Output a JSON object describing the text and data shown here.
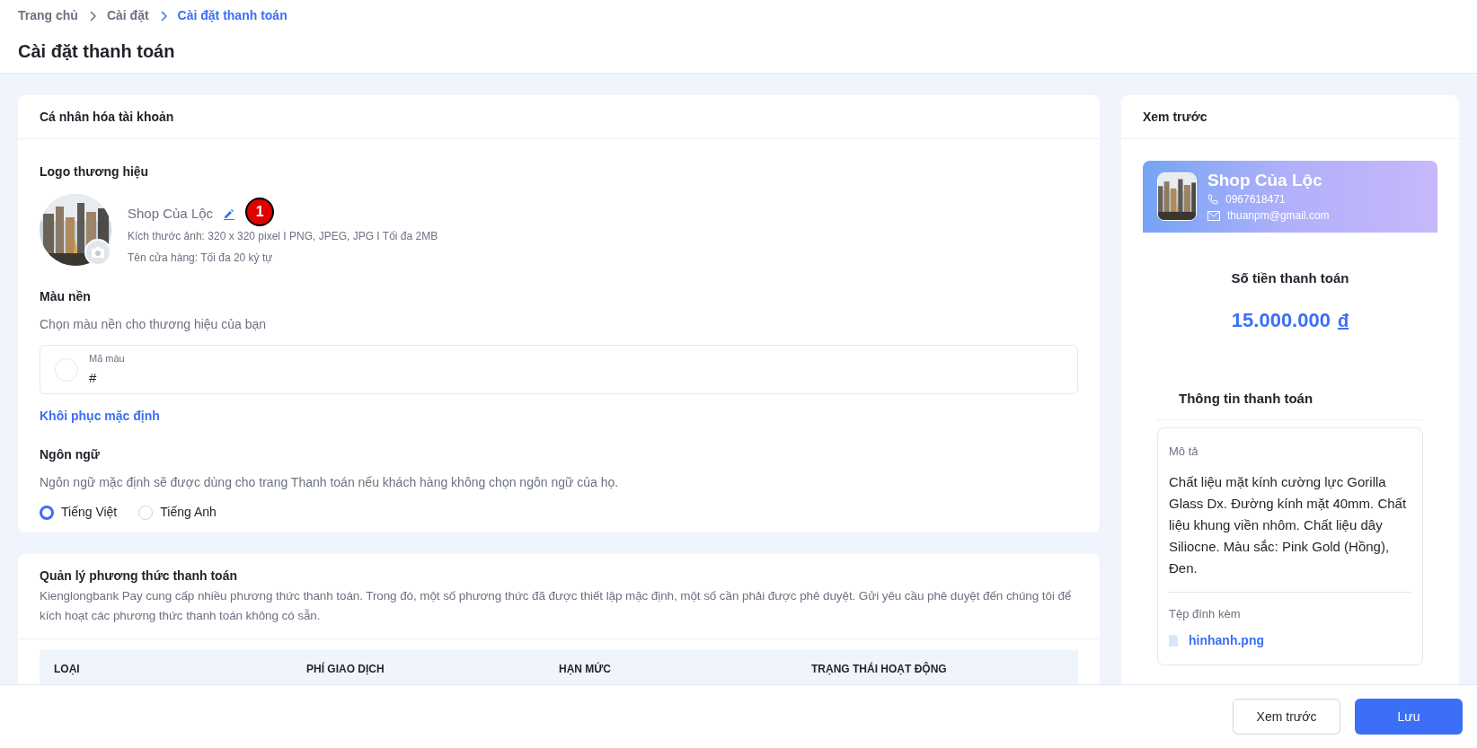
{
  "breadcrumb": [
    {
      "label": "Trang chủ",
      "current": false
    },
    {
      "label": "Cài đặt",
      "current": false
    },
    {
      "label": "Cài đặt thanh toán",
      "current": true
    }
  ],
  "page_title": "Cài đặt thanh toán",
  "personalization": {
    "title": "Cá nhân hóa tài khoản",
    "logo": {
      "heading": "Logo thương hiệu",
      "shop_name": "Shop Của Lộc",
      "badge": "1",
      "size_hint": "Kích thước ảnh: 320 x 320 pixel I PNG, JPEG, JPG I Tối đa 2MB",
      "name_hint": "Tên cửa hàng: Tối đa 20 ký tự"
    },
    "background": {
      "heading": "Màu nền",
      "description": "Chọn màu nền cho thương hiệu của bạn",
      "field_label": "Mã màu",
      "value": "#",
      "reset_link": "Khôi phục mặc định"
    },
    "language": {
      "heading": "Ngôn ngữ",
      "description": "Ngôn ngữ mặc định sẽ được dùng cho trang Thanh toán nếu khách hàng không chọn ngôn ngữ của họ.",
      "options": [
        {
          "label": "Tiếng Việt",
          "selected": true
        },
        {
          "label": "Tiếng Anh",
          "selected": false
        }
      ]
    }
  },
  "payment_methods": {
    "title": "Quản lý phương thức thanh toán",
    "description": "Kienglongbank Pay cung cấp nhiều phương thức thanh toán. Trong đó, một số phương thức đã được thiết lập mặc định, một số cần phải được phê duyệt. Gửi yêu cầu phê duyệt đến chúng tôi để kích hoạt các phương thức thanh toán không có sẵn.",
    "columns": [
      "LOẠI",
      "PHÍ GIAO DỊCH",
      "HẠN MỨC",
      "TRẠNG THÁI HOẠT ĐỘNG"
    ]
  },
  "preview": {
    "title": "Xem trước",
    "shop_name": "Shop Của Lộc",
    "phone": "0967618471",
    "email": "thuanpm@gmail.com",
    "amount_label": "Số tiền thanh toán",
    "amount": "15.000.000",
    "currency": "đ",
    "info_title": "Thông tin thanh toán",
    "description_label": "Mô tả",
    "description": "Chất liệu mặt kính cường lực Gorilla Glass Dx. Đường kính mặt 40mm. Chất liệu khung viền nhôm. Chất liệu dây Siliocne. Màu sắc: Pink Gold (Hồng), Đen.",
    "attachment_label": "Tệp đính kèm",
    "attachment": "hinhanh.png"
  },
  "buttons": [
    {
      "label": "Xem trước",
      "kind": "secondary"
    },
    {
      "label": "Lưu",
      "kind": "primary"
    }
  ]
}
